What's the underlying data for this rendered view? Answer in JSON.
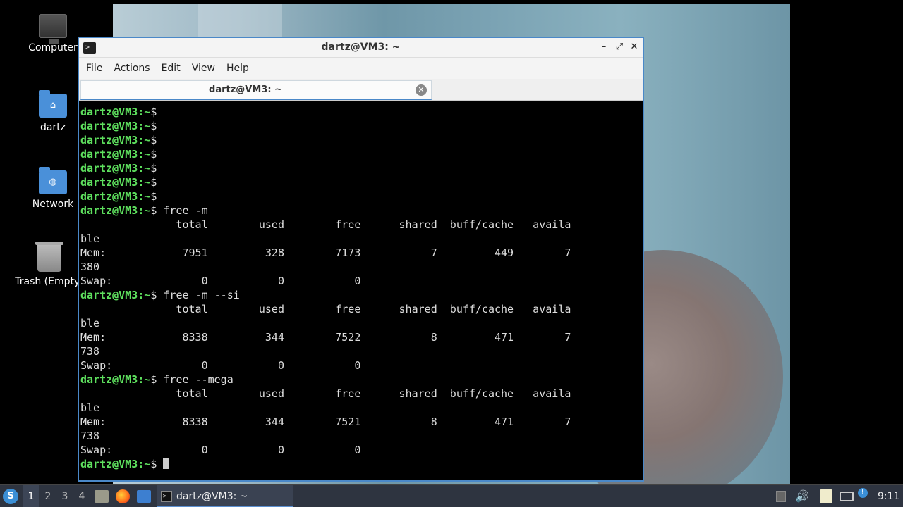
{
  "desktop": {
    "icons": [
      {
        "label": "Computer",
        "icon": "computer-icon"
      },
      {
        "label": "dartz",
        "icon": "home-folder-icon"
      },
      {
        "label": "Network",
        "icon": "network-folder-icon"
      },
      {
        "label": "Trash (Empty)",
        "icon": "trash-icon"
      }
    ]
  },
  "window": {
    "title": "dartz@VM3: ~",
    "menu": [
      "File",
      "Actions",
      "Edit",
      "View",
      "Help"
    ],
    "tab_label": "dartz@VM3: ~",
    "controls": {
      "minimize": "–",
      "maximize": "⤢",
      "close": "✕"
    }
  },
  "terminal": {
    "prompt_user": "dartz@VM3",
    "prompt_path": ":~",
    "prompt_symbol": "$",
    "lines": [
      {
        "type": "prompt",
        "cmd": ""
      },
      {
        "type": "prompt",
        "cmd": ""
      },
      {
        "type": "prompt",
        "cmd": ""
      },
      {
        "type": "prompt",
        "cmd": ""
      },
      {
        "type": "prompt",
        "cmd": ""
      },
      {
        "type": "prompt",
        "cmd": ""
      },
      {
        "type": "prompt",
        "cmd": ""
      },
      {
        "type": "prompt",
        "cmd": " free -m"
      },
      {
        "type": "out",
        "text": "               total        used        free      shared  buff/cache   availa"
      },
      {
        "type": "out",
        "text": "ble"
      },
      {
        "type": "out",
        "text": "Mem:            7951         328        7173           7         449        7"
      },
      {
        "type": "out",
        "text": "380"
      },
      {
        "type": "out",
        "text": "Swap:              0           0           0"
      },
      {
        "type": "prompt",
        "cmd": " free -m --si"
      },
      {
        "type": "out",
        "text": "               total        used        free      shared  buff/cache   availa"
      },
      {
        "type": "out",
        "text": "ble"
      },
      {
        "type": "out",
        "text": "Mem:            8338         344        7522           8         471        7"
      },
      {
        "type": "out",
        "text": "738"
      },
      {
        "type": "out",
        "text": "Swap:              0           0           0"
      },
      {
        "type": "prompt",
        "cmd": " free --mega"
      },
      {
        "type": "out",
        "text": "               total        used        free      shared  buff/cache   availa"
      },
      {
        "type": "out",
        "text": "ble"
      },
      {
        "type": "out",
        "text": "Mem:            8338         344        7521           8         471        7"
      },
      {
        "type": "out",
        "text": "738"
      },
      {
        "type": "out",
        "text": "Swap:              0           0           0"
      },
      {
        "type": "prompt",
        "cmd": " ",
        "cursor": true
      }
    ]
  },
  "taskbar": {
    "workspaces": [
      "1",
      "2",
      "3",
      "4"
    ],
    "active_workspace": "1",
    "task_label": "dartz@VM3: ~",
    "clock": "9:11"
  }
}
